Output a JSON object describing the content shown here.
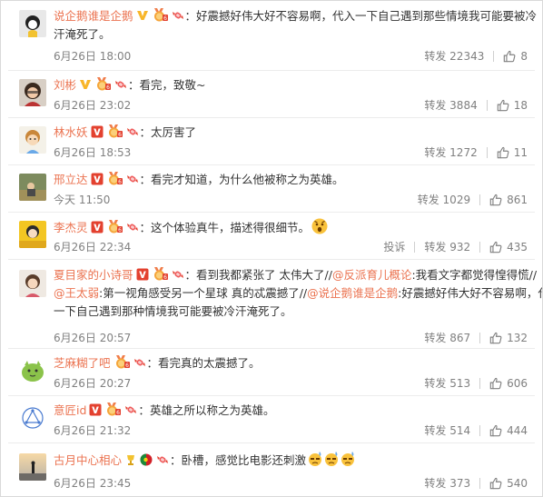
{
  "colors": {
    "username": "#eb7350",
    "text": "#333333",
    "meta": "#808080",
    "vip_red": "#e3412f",
    "vip_yellow": "#f8b62a"
  },
  "comments": [
    {
      "username": "说企鹅谁是企鹅",
      "colon": "：",
      "text_line1": "好震撼好伟大好不容易啊，代入一下自己遇到那些情境我可能要被冷",
      "text_line2": "汗淹死了。",
      "date": "6月26日 18:00",
      "repost_label": "转发",
      "repost_count": "22343",
      "like_count": "8",
      "badges": [
        "vip-yellow-icon",
        "medal-icon",
        "fan-candy-icon"
      ]
    },
    {
      "username": "刘彬",
      "colon": "：",
      "text_line1": "看完，致敬~",
      "date": "6月26日 23:02",
      "repost_label": "转发",
      "repost_count": "3884",
      "like_count": "18",
      "badges": [
        "vip-yellow-icon",
        "medal-icon",
        "fan-candy-icon"
      ]
    },
    {
      "username": "林水妖",
      "colon": "：",
      "text_line1": "太厉害了",
      "date": "6月26日 18:53",
      "repost_label": "转发",
      "repost_count": "1272",
      "like_count": "11",
      "badges": [
        "vip-red-icon",
        "medal-icon",
        "fan-candy-icon"
      ]
    },
    {
      "username": "邢立达",
      "colon": "：",
      "text_line1": "看完才知道，为什么他被称之为英雄。",
      "date": "今天 11:50",
      "repost_label": "转发",
      "repost_count": "1029",
      "like_count": "861",
      "badges": [
        "vip-red-icon",
        "medal-icon",
        "fan-candy-icon"
      ]
    },
    {
      "username": "李杰灵",
      "colon": "：",
      "text_line1": "这个体验真牛，描述得很细节。",
      "date": "6月26日 22:34",
      "report_label": "投诉",
      "repost_label": "转发",
      "repost_count": "932",
      "like_count": "435",
      "badges": [
        "vip-red-icon",
        "medal-icon",
        "fan-candy-icon"
      ]
    },
    {
      "username": "夏目家的小诗哥",
      "colon": "：",
      "text_part1": "看到我都紧张了 太伟大了//",
      "mention1": "@反派育儿概论",
      "text_part2": ":我看文字都觉得惶得慌//",
      "mention2": "@王太弱",
      "text_part3": ":第一视角感受另一个星球 真的忒震撼了//",
      "mention3": "@说企鹅谁是企鹅",
      "text_part4": ":好震撼好伟大好不容易啊，代入",
      "text_line3": "一下自己遇到那种情境我可能要被冷汗淹死了。",
      "date": "6月26日 20:57",
      "repost_label": "转发",
      "repost_count": "867",
      "like_count": "132",
      "badges": [
        "vip-red-icon",
        "medal-icon",
        "fan-candy-icon"
      ]
    },
    {
      "username": "芝麻糊了吧",
      "colon": "：",
      "text_line1": "看完真的太震撼了。",
      "date": "6月26日 20:27",
      "repost_label": "转发",
      "repost_count": "513",
      "like_count": "606",
      "badges": [
        "medal-icon",
        "fan-candy-icon"
      ]
    },
    {
      "username": "意匠id",
      "colon": "：",
      "text_line1": "英雄之所以称之为英雄。",
      "date": "6月26日 21:32",
      "repost_label": "转发",
      "repost_count": "514",
      "like_count": "444",
      "badges": [
        "vip-red-icon",
        "medal-icon",
        "fan-candy-icon"
      ]
    },
    {
      "username": "古月中心相心",
      "colon": "：",
      "text_line1": "卧槽，感觉比电影还刺激",
      "date": "6月26日 23:45",
      "repost_label": "转发",
      "repost_count": "373",
      "like_count": "540",
      "badges": [
        "trophy-icon",
        "portugal-flag-icon",
        "fan-candy-icon"
      ]
    }
  ]
}
